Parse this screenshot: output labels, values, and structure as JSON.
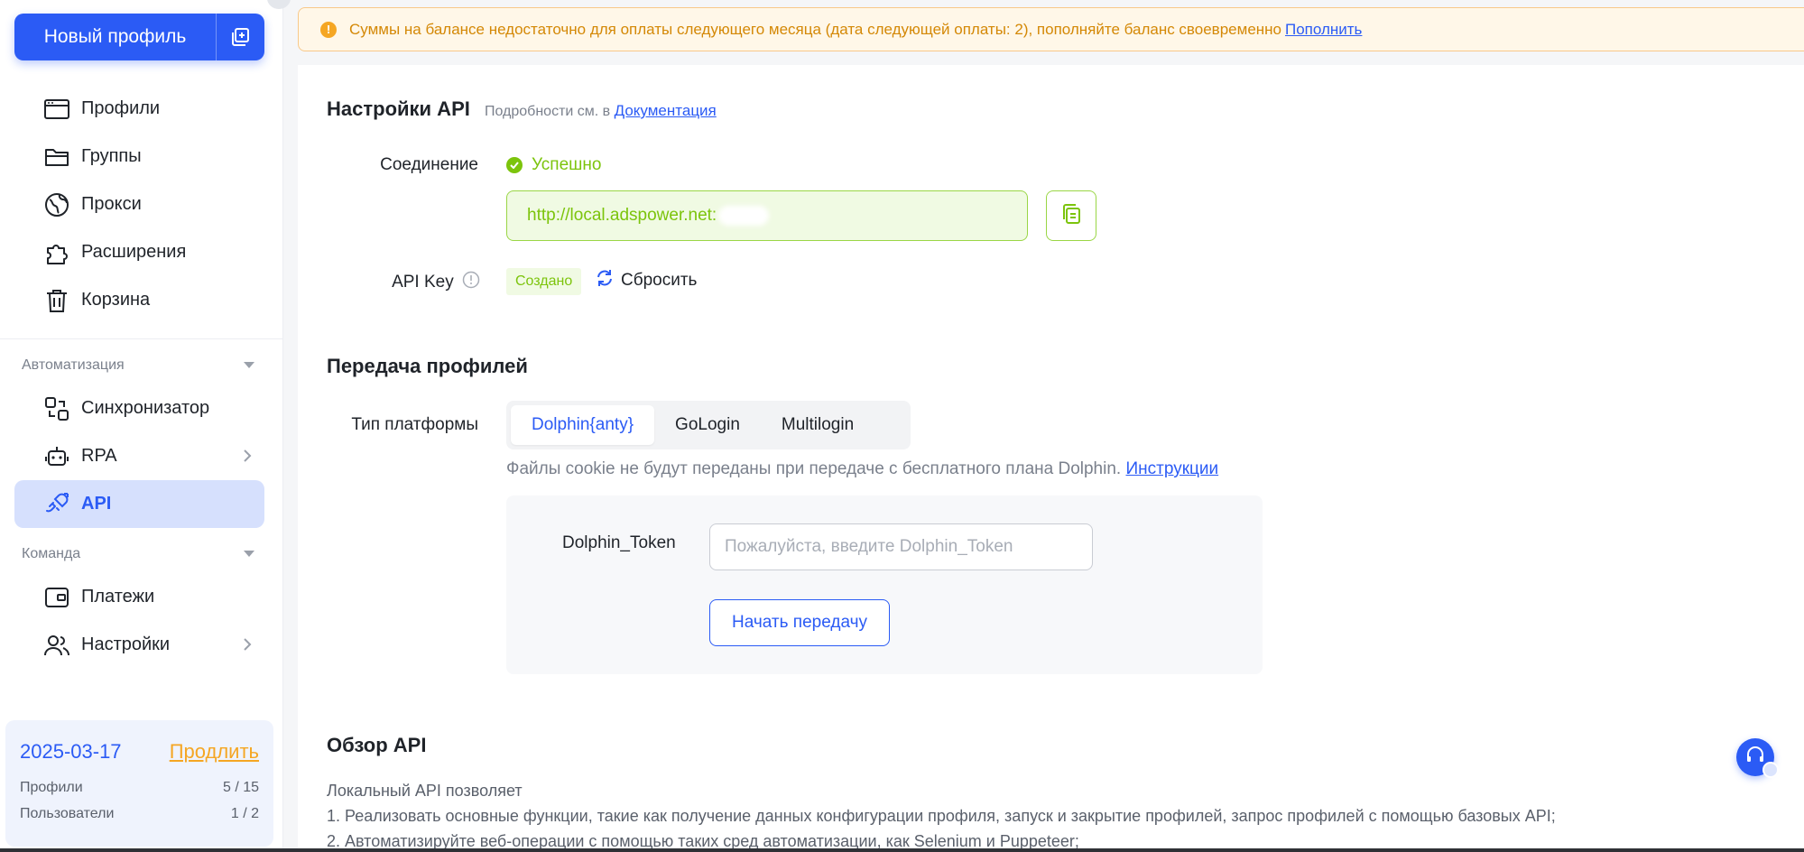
{
  "sidebar": {
    "new_profile_label": "Новый профиль",
    "items": [
      {
        "label": "Профили",
        "icon": "browser-window-icon"
      },
      {
        "label": "Группы",
        "icon": "folder-icon"
      },
      {
        "label": "Прокси",
        "icon": "globe-icon"
      },
      {
        "label": "Расширения",
        "icon": "puzzle-icon"
      },
      {
        "label": "Корзина",
        "icon": "trash-icon"
      }
    ],
    "automation": {
      "header": "Автоматизация",
      "items": [
        {
          "label": "Синхронизатор",
          "icon": "sync-icon"
        },
        {
          "label": "RPA",
          "icon": "robot-icon"
        },
        {
          "label": "API",
          "icon": "plug-icon"
        }
      ]
    },
    "team": {
      "header": "Команда",
      "items": [
        {
          "label": "Платежи",
          "icon": "wallet-icon"
        },
        {
          "label": "Настройки",
          "icon": "users-icon"
        }
      ]
    },
    "plan": {
      "date": "2025-03-17",
      "renew_label": "Продлить",
      "profiles_label": "Профили",
      "profiles_value": "5 / 15",
      "users_label": "Пользователи",
      "users_value": "1 / 2"
    }
  },
  "alert": {
    "text": "Суммы на балансе недостаточно для оплаты следующего месяца (дата следующей оплаты: 2), пополняйте баланс своевременно",
    "link": "Пополнить"
  },
  "api_settings": {
    "title": "Настройки API",
    "note": "Подробности см. в",
    "doc_link": "Документация",
    "connection_label": "Соединение",
    "connection_status": "Успешно",
    "url": "http://local.adspower.net:",
    "api_key_label": "API Key",
    "api_key_status": "Создано",
    "reset_label": "Сбросить"
  },
  "transfer": {
    "title": "Передача профилей",
    "platform_label": "Тип платформы",
    "tabs": [
      "Dolphin{anty}",
      "GoLogin",
      "Multilogin"
    ],
    "hint": "Файлы cookie не будут переданы при передаче с бесплатного плана Dolphin.",
    "hint_link": "Инструкции",
    "token_label": "Dolphin_Token",
    "token_placeholder": "Пожалуйста, введите Dolphin_Token",
    "start_label": "Начать передачу"
  },
  "overview": {
    "title": "Обзор API",
    "lines": [
      "Локальный API позволяет",
      "1. Реализовать основные функции, такие как получение данных конфигурации профиля, запуск и закрытие профилей, запрос профилей с помощью базовых API;",
      "2. Автоматизируйте веб-операции с помощью таких сред автоматизации, как Selenium и Puppeteer;"
    ]
  },
  "colors": {
    "primary": "#2b5bf5",
    "success": "#7cc40c",
    "warning": "#f5a623"
  }
}
